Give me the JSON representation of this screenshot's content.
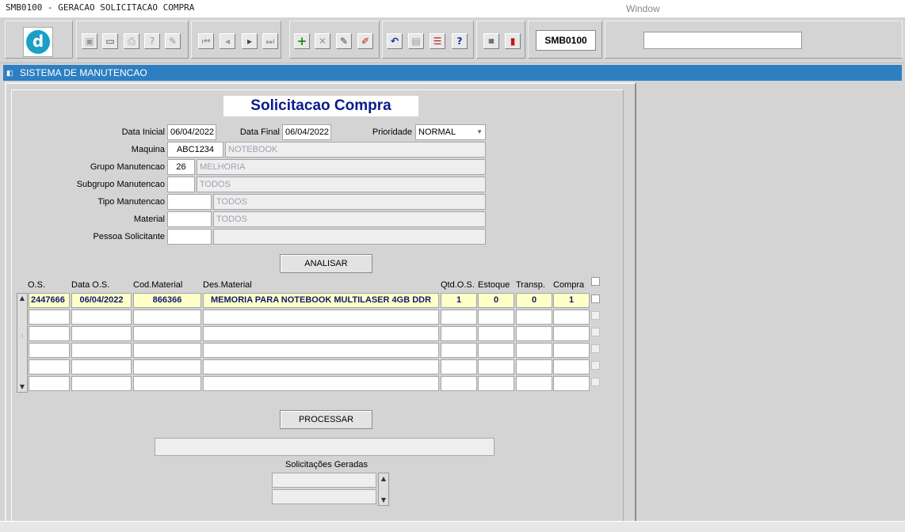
{
  "titlebar": {
    "title": "SMB0100 - GERACAO SOLICITACAO COMPRA",
    "menu_window": "Window"
  },
  "toolbar": {
    "logo_letter": "d",
    "form_code": "SMB0100",
    "search_value": ""
  },
  "window": {
    "title": "SISTEMA DE MANUTENCAO"
  },
  "form": {
    "title": "Solicitacao Compra",
    "data_inicial_label": "Data Inicial",
    "data_inicial": "06/04/2022",
    "data_final_label": "Data Final",
    "data_final": "06/04/2022",
    "prioridade_label": "Prioridade",
    "prioridade": "NORMAL",
    "maquina_label": "Maquina",
    "maquina_code": "ABC1234",
    "maquina_desc": "NOTEBOOK",
    "grupo_label": "Grupo Manutencao",
    "grupo_code": "26",
    "grupo_desc": "MELHORIA",
    "subgrupo_label": "Subgrupo Manutencao",
    "subgrupo_code": "",
    "subgrupo_desc": "TODOS",
    "tipo_label": "Tipo Manutencao",
    "tipo_code": "",
    "tipo_desc": "TODOS",
    "material_label": "Material",
    "material_code": "",
    "material_desc": "TODOS",
    "pessoa_label": "Pessoa Solicitante",
    "pessoa_code": "",
    "pessoa_desc": "",
    "analisar": "ANALISAR",
    "processar": "PROCESSAR",
    "status": "",
    "solicitacoes_label": "Solicitações Geradas"
  },
  "grid": {
    "headers": [
      "O.S.",
      "Data O.S.",
      "Cod.Material",
      "Des.Material",
      "Qtd.O.S.",
      "Estoque",
      "Transp.",
      "Compra"
    ],
    "rows": [
      [
        "2447666",
        "06/04/2022",
        "866366",
        "MEMORIA PARA NOTEBOOK MULTILASER 4GB DDR",
        "1",
        "0",
        "0",
        "1"
      ],
      [
        "",
        "",
        "",
        "",
        "",
        "",
        "",
        ""
      ],
      [
        "",
        "",
        "",
        "",
        "",
        "",
        "",
        ""
      ],
      [
        "",
        "",
        "",
        "",
        "",
        "",
        "",
        ""
      ],
      [
        "",
        "",
        "",
        "",
        "",
        "",
        "",
        ""
      ],
      [
        "",
        "",
        "",
        "",
        "",
        "",
        "",
        ""
      ]
    ]
  },
  "colors": {
    "header_blue": "#2d7fc2",
    "title_navy": "#0b1a8e",
    "highlight_row": "#ffffc8"
  }
}
